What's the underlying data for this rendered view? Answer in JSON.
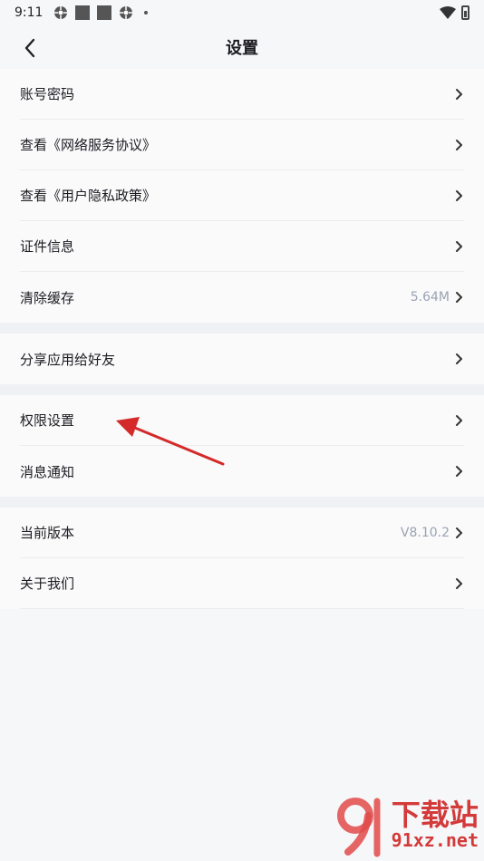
{
  "status_bar": {
    "time": "9:11",
    "left_icons": [
      "gear-icon",
      "square-icon",
      "square-icon",
      "gear-icon",
      "dot-icon"
    ],
    "right_icons": [
      "wifi-icon",
      "battery-icon"
    ]
  },
  "header": {
    "title": "设置",
    "back_icon": "chevron-left-icon"
  },
  "groups": [
    {
      "items": [
        {
          "label": "账号密码",
          "value": ""
        },
        {
          "label": "查看《网络服务协议》",
          "value": ""
        },
        {
          "label": "查看《用户隐私政策》",
          "value": ""
        },
        {
          "label": "证件信息",
          "value": ""
        },
        {
          "label": "清除缓存",
          "value": "5.64M"
        }
      ]
    },
    {
      "items": [
        {
          "label": "分享应用给好友",
          "value": ""
        }
      ]
    },
    {
      "items": [
        {
          "label": "权限设置",
          "value": ""
        },
        {
          "label": "消息通知",
          "value": ""
        }
      ]
    },
    {
      "items": [
        {
          "label": "当前版本",
          "value": "V8.10.2"
        },
        {
          "label": "关于我们",
          "value": ""
        }
      ]
    }
  ],
  "colors": {
    "background": "#f6f7f9",
    "separator": "#f0f1f4",
    "value_text": "#9aa3b2",
    "annotation_arrow": "#d42a2a"
  },
  "watermark": {
    "title": "下载站",
    "sub": "91xz.net"
  }
}
